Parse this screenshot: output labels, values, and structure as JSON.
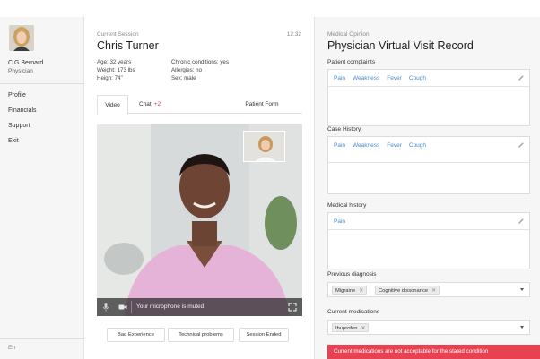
{
  "sidebar": {
    "user": {
      "name": "C.G.Bernard",
      "role": "Physician"
    },
    "items": [
      {
        "label": "Profile"
      },
      {
        "label": "Financials"
      },
      {
        "label": "Support"
      },
      {
        "label": "Exit"
      }
    ],
    "language": "En"
  },
  "session": {
    "eyebrow": "Current Session",
    "time": "12:32",
    "patient_name": "Chris Turner",
    "info_left": [
      "Age: 32 years",
      "Weight: 173 lbs",
      "Heigh: 74''"
    ],
    "info_right": [
      "Chronic conditions: yes",
      "Allergies: no",
      "Sex: male"
    ],
    "tabs": {
      "video": "Video",
      "chat": "Chat",
      "chat_badge": "+2",
      "form": "Patient Form"
    },
    "video": {
      "mic_status": "Your microphone is muted"
    },
    "actions": [
      "Bad Experience",
      "Technical problems",
      "Session Ended"
    ]
  },
  "opinion": {
    "eyebrow": "Medical Opinion",
    "title": "Physician Virtual Visit Record",
    "complaints": {
      "label": "Patient complaints",
      "tags": [
        "Pain",
        "Weakness",
        "Fever",
        "Cough"
      ]
    },
    "case_history": {
      "label": "Case History",
      "tags": [
        "Pain",
        "Weakness",
        "Fever",
        "Cough"
      ]
    },
    "medical_history": {
      "label": "Medical history",
      "tags": [
        "Pain"
      ]
    },
    "previous_diagnosis": {
      "label": "Previous diagnosis",
      "chips": [
        "Migraine",
        "Cognitive dissonance"
      ]
    },
    "current_medications": {
      "label": "Current medications",
      "chips": [
        "Ibuprofen"
      ]
    },
    "alert": "Current medications are not acceptable for the stated condition"
  },
  "colors": {
    "accent": "#4a8ad4",
    "alert": "#e74152",
    "badge": "#e0394b"
  },
  "icons": {
    "pencil": "pencil-icon",
    "mic": "microphone-icon",
    "camera": "video-camera-icon",
    "fullscreen": "fullscreen-icon",
    "caret": "chevron-down-icon"
  }
}
